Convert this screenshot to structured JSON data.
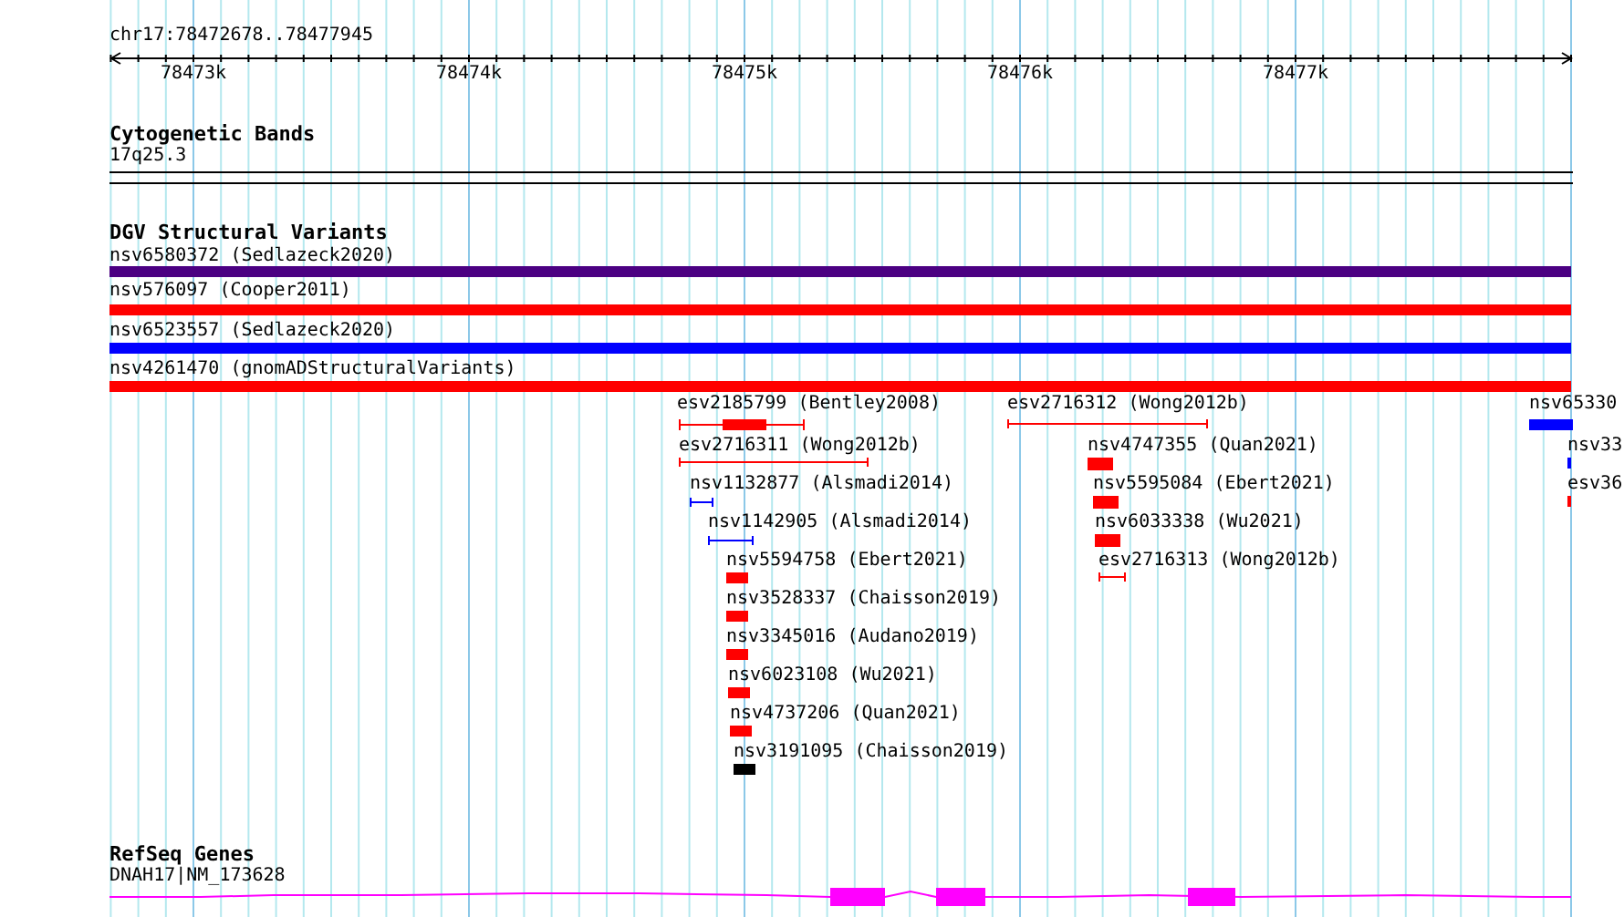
{
  "location": "chr17:78472678..78477945",
  "ruler": {
    "ticks": [
      "78473k",
      "78474k",
      "78475k",
      "78476k",
      "78477k"
    ]
  },
  "tracks": [
    {
      "title": "Cytogenetic Bands",
      "features": [
        {
          "label": "17q25.3",
          "kind": "band",
          "color": "#000000"
        }
      ]
    },
    {
      "title": "DGV Structural Variants",
      "features": [
        {
          "label": "nsv6580372 (Sedlazeck2020)",
          "kind": "box",
          "color": "#4b0082"
        },
        {
          "label": "nsv576097 (Cooper2011)",
          "kind": "box",
          "color": "#ff0000"
        },
        {
          "label": "nsv6523557 (Sedlazeck2020)",
          "kind": "box",
          "color": "#0000ff"
        },
        {
          "label": "nsv4261470 (gnomADStructuralVariants)",
          "kind": "box",
          "color": "#ff0000"
        },
        {
          "label": "esv2185799 (Bentley2008)",
          "kind": "line_box",
          "color": "#ff0000"
        },
        {
          "label": "esv2716311 (Wong2012b)",
          "kind": "line",
          "color": "#ff0000"
        },
        {
          "label": "nsv1132877 (Alsmadi2014)",
          "kind": "line",
          "color": "#0000ff"
        },
        {
          "label": "nsv1142905 (Alsmadi2014)",
          "kind": "line",
          "color": "#0000ff"
        },
        {
          "label": "nsv5594758 (Ebert2021)",
          "kind": "box",
          "color": "#ff0000"
        },
        {
          "label": "nsv3528337 (Chaisson2019)",
          "kind": "box",
          "color": "#ff0000"
        },
        {
          "label": "nsv3345016 (Audano2019)",
          "kind": "box",
          "color": "#ff0000"
        },
        {
          "label": "nsv6023108 (Wu2021)",
          "kind": "box",
          "color": "#ff0000"
        },
        {
          "label": "nsv4737206 (Quan2021)",
          "kind": "box",
          "color": "#ff0000"
        },
        {
          "label": "nsv3191095 (Chaisson2019)",
          "kind": "box",
          "color": "#000000"
        },
        {
          "label": "esv2716312 (Wong2012b)",
          "kind": "line",
          "color": "#ff0000"
        },
        {
          "label": "nsv4747355 (Quan2021)",
          "kind": "box",
          "color": "#ff0000"
        },
        {
          "label": "nsv5595084 (Ebert2021)",
          "kind": "box",
          "color": "#ff0000"
        },
        {
          "label": "nsv6033338 (Wu2021)",
          "kind": "box",
          "color": "#ff0000"
        },
        {
          "label": "esv2716313 (Wong2012b)",
          "kind": "line",
          "color": "#ff0000"
        },
        {
          "label": "nsv65330",
          "kind": "box",
          "color": "#0000ff"
        },
        {
          "label": "nsv33",
          "kind": "box",
          "color": "#0000ff"
        },
        {
          "label": "esv36",
          "kind": "box",
          "color": "#ff0000"
        }
      ]
    },
    {
      "title": "RefSeq Genes",
      "features": [
        {
          "label": "DNAH17|NM_173628",
          "kind": "gene",
          "color": "#ff00ff"
        }
      ]
    }
  ]
}
